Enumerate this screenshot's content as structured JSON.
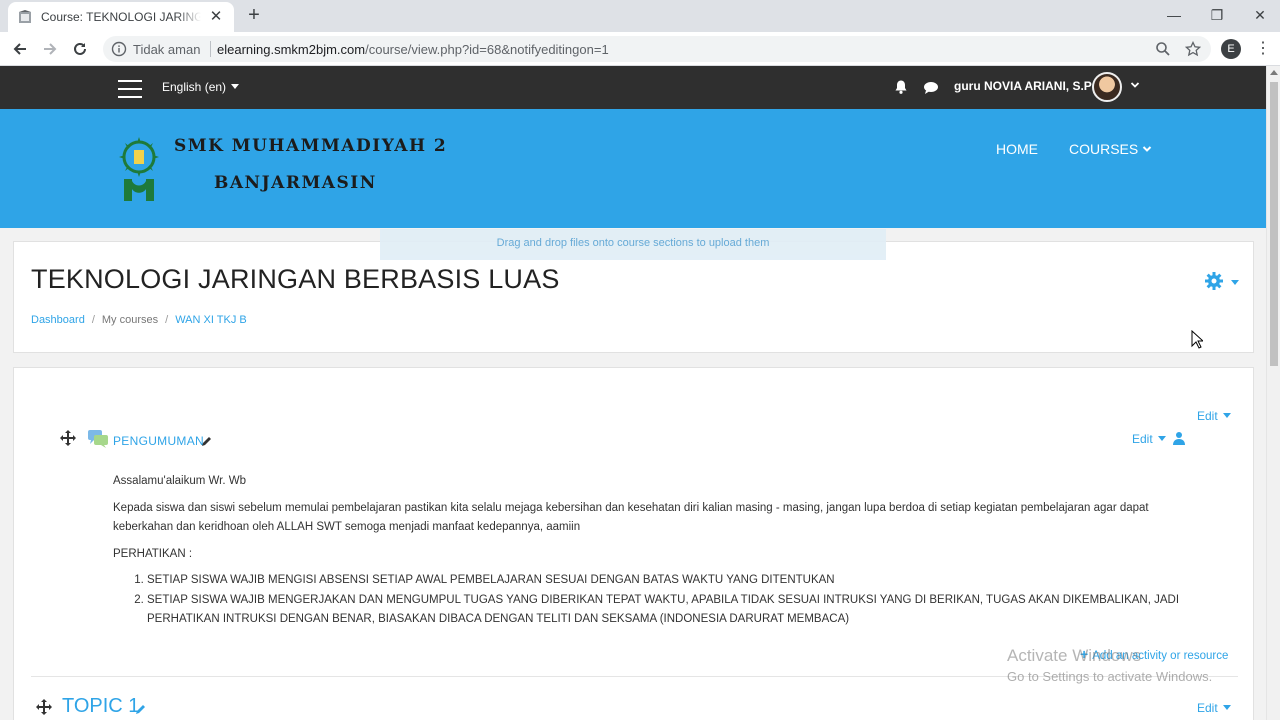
{
  "browser": {
    "tab_title": "Course: TEKNOLOGI JARINGAN B",
    "tab_close": "✕",
    "new_tab": "+",
    "security_label": "Tidak aman",
    "url_host": "elearning.smkm2bjm.com",
    "url_path": "/course/view.php?id=68&notifyeditingon=1",
    "profile_initial": "E",
    "window_controls": {
      "minimize": "—",
      "maximize": "❐",
      "close": "✕"
    }
  },
  "navbar": {
    "language": "English (en)",
    "username": "guru NOVIA ARIANI, S.Pd"
  },
  "banner": {
    "school_line1": "SMK MUHAMMADIYAH 2",
    "school_line2": "BANJARMASIN",
    "nav_home": "HOME",
    "nav_courses": "COURSES",
    "background_color": "#2fa4e7"
  },
  "page_header": {
    "dnd_notice": "Drag and drop files onto course sections to upload them",
    "course_title": "TEKNOLOGI JARINGAN BERBASIS LUAS",
    "breadcrumb": [
      "Dashboard",
      "My courses",
      "WAN XI TKJ B"
    ]
  },
  "section0": {
    "edit_label": "Edit",
    "activity": {
      "name": "PENGUMUMAN",
      "edit_label": "Edit"
    },
    "summary": {
      "greeting": "Assalamu'alaikum Wr. Wb",
      "paragraph": "Kepada siswa dan siswi sebelum memulai pembelajaran pastikan kita selalu mejaga kebersihan dan kesehatan diri kalian masing - masing, jangan lupa berdoa di setiap kegiatan pembelajaran agar dapat keberkahan dan keridhoan oleh ALLAH SWT semoga menjadi manfaat kedepannya, aamiin",
      "attention": "PERHATIKAN :",
      "items": [
        "SETIAP SISWA WAJIB MENGISI ABSENSI SETIAP AWAL PEMBELAJARAN SESUAI DENGAN BATAS WAKTU YANG DITENTUKAN",
        "SETIAP SISWA WAJIB MENGERJAKAN DAN MENGUMPUL TUGAS YANG DIBERIKAN TEPAT WAKTU, APABILA TIDAK SESUAI INTRUKSI YANG DI BERIKAN, TUGAS AKAN DIKEMBALIKAN, JADI PERHATIKAN INTRUKSI DENGAN BENAR, BIASAKAN DIBACA DENGAN TELITI DAN SEKSAMA (INDONESIA DARURAT MEMBACA)"
      ]
    },
    "add_activity": "Add an activity or resource"
  },
  "section1": {
    "title": "TOPIC 1",
    "edit_label": "Edit"
  },
  "watermark": {
    "line1": "Activate Windows",
    "line2": "Go to Settings to activate Windows."
  }
}
